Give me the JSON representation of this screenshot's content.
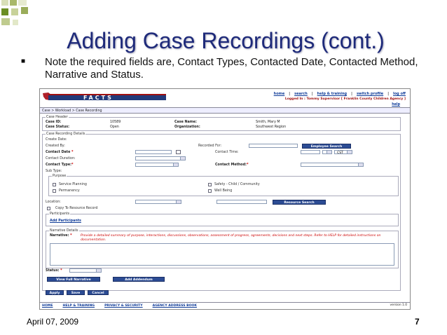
{
  "slide": {
    "title": "Adding Case Recordings (cont.)",
    "bullet": "Note the required fields are, Contact Types, Contacted Date, Contacted Method, Narrative and Status.",
    "date": "April 07, 2009",
    "slide_number": "7",
    "colors": {
      "title": "#1e2a7a",
      "accent": "#6b8e23",
      "button": "#2c4c94"
    }
  },
  "app": {
    "logo_text": "FACTS",
    "nav": {
      "home": "home",
      "search": "search",
      "help_training": "help & training",
      "switch_profile": "switch profile",
      "log_off": "log off",
      "separator": "|"
    },
    "logged_in": "Logged In : Tommy Supervisor [ Franklin County Children Agency ]",
    "help": "help",
    "breadcrumb": "Case > Workload > Case Recording",
    "case_header": {
      "legend": "Case Header",
      "case_id_label": "Case ID:",
      "case_id": "10589",
      "case_status_label": "Case Status:",
      "case_status": "Open",
      "case_name_label": "Case Name:",
      "case_name": "Smith, Mary M",
      "organization_label": "Organization:",
      "organization": "Southwest Region"
    },
    "details": {
      "legend": "Case Recording Details",
      "create_date": "Create Date:",
      "created_by": "Created By:",
      "recorded_for": "Recorded For:",
      "employee_search": "Employee Search",
      "contact_date": "Contact Date",
      "contact_time": "Contact Time:",
      "time_zone": "CST",
      "contact_duration": "Contact Duration:",
      "contact_type": "Contact Type:",
      "contact_method": "Contact Method:",
      "sub_type": "Sub Type:",
      "required_mark": "*"
    },
    "purpose": {
      "legend": "Purpose",
      "items": [
        "Service Planning",
        "Permanency",
        "Safety - Child / Community",
        "Well Being"
      ]
    },
    "location": "Location:",
    "resource_search": "Resource Search",
    "copy_to_resource": "Copy To Resource Record",
    "participants": {
      "legend": "Participants",
      "add": "Add Participants"
    },
    "narrative": {
      "legend": "Narrative Details",
      "label": "Narrative:",
      "hint": "Provide a detailed summary of purpose, interactions, discussions, observations, assessment of progress, agreements, decisions and next steps. Refer to HELP for detailed instructions on documentation."
    },
    "status": "Status:",
    "view_full_narrative": "View Full Narrative",
    "add_addendum": "Add Addendum",
    "apply": "Apply",
    "save": "Save",
    "cancel": "Cancel",
    "bottom_nav": [
      "HOME",
      "HELP & TRAINING",
      "PRIVACY & SECURITY",
      "AGENCY ADDRESS BOOK"
    ],
    "version": "version 1.0"
  }
}
